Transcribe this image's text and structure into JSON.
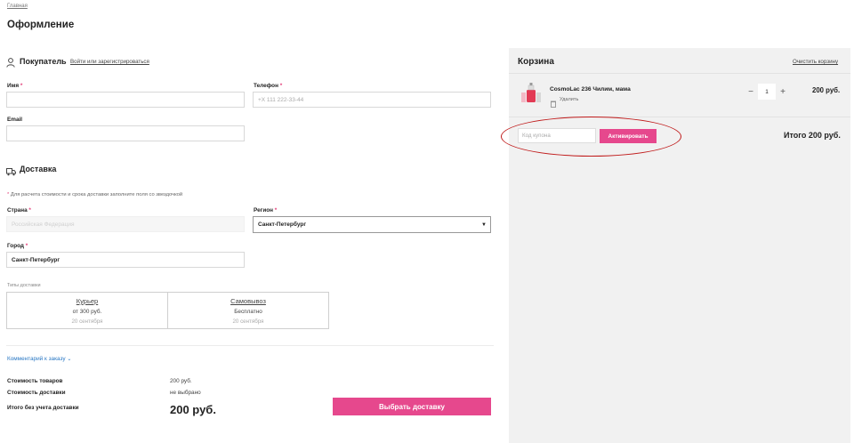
{
  "breadcrumb": "Главная",
  "page_title": "Оформление",
  "buyer": {
    "title": "Покупатель",
    "login_link": "Войти или зарегистрироваться",
    "name_label": "Имя",
    "phone_label": "Телефон",
    "phone_placeholder": "+X 111 222-33-44",
    "email_label": "Email",
    "required_mark": "*"
  },
  "delivery": {
    "title": "Доставка",
    "hint": "Для расчета стоимости и срока доставки заполните поля со звездочкой",
    "country_label": "Страна",
    "country_value": "Российская Федерация",
    "region_label": "Регион",
    "region_value": "Санкт-Петербург",
    "city_label": "Город",
    "city_value": "Санкт-Петербург",
    "types_label": "Типы доставки",
    "options": [
      {
        "name": "Курьер",
        "price": "от 300 руб.",
        "date": "20 сентября"
      },
      {
        "name": "Самовывоз",
        "price": "Бесплатно",
        "date": "20 сентября"
      }
    ]
  },
  "comment_link": "Комментарий к заказу",
  "summary": {
    "goods_label": "Стоимость товаров",
    "goods_value": "200 руб.",
    "delivery_label": "Стоимость доставки",
    "delivery_value": "не выбрано",
    "total_label": "Итого без учета доставки",
    "total_value": "200 руб.",
    "choose_button": "Выбрать доставку"
  },
  "cart": {
    "title": "Корзина",
    "clear_link": "Очистить корзину",
    "item": {
      "name": "CosmoLac 236 Чилим, мама",
      "remove": "Удалить",
      "quantity": "1",
      "price": "200 руб."
    },
    "coupon_placeholder": "Код купона",
    "activate_button": "Активировать",
    "total": "Итого 200 руб."
  },
  "colors": {
    "accent": "#e6488d",
    "annotation": "#c01b1b",
    "link": "#2a78c4"
  }
}
